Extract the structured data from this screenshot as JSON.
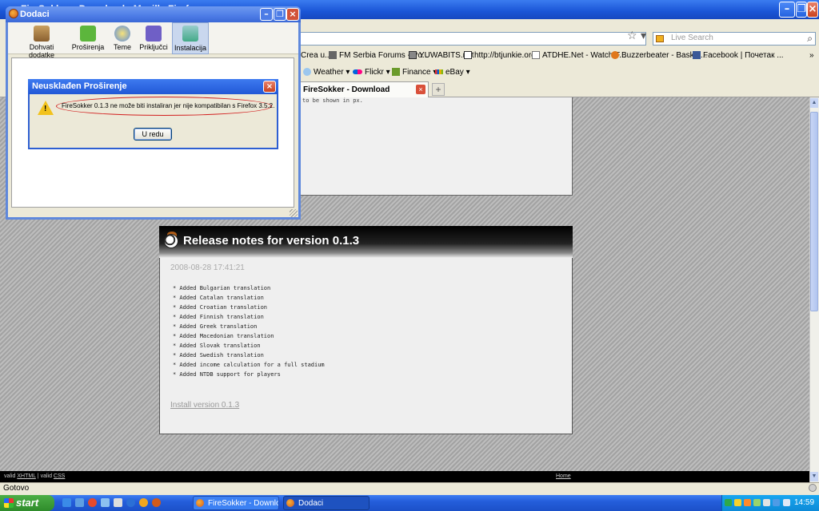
{
  "firefox": {
    "title": "FireSokker - Download - Mozilla Firefox",
    "search_placeholder": "Live Search",
    "bookmarks": [
      {
        "label": "Crea u...",
        "icon": "page-icon"
      },
      {
        "label": "FM Serbia Forums - Po...",
        "icon": "forum-icon"
      },
      {
        "label": "YUWABITS.net",
        "icon": "page-icon"
      },
      {
        "label": "http://btjunkie.org",
        "icon": "page-icon"
      },
      {
        "label": "ATDHE.Net - Watch F...",
        "icon": "page-icon"
      },
      {
        "label": "Buzzerbeater - Basket...",
        "icon": "basketball-icon"
      },
      {
        "label": "Facebook | Почетак ...",
        "icon": "facebook-icon"
      }
    ],
    "bookmarks2": [
      {
        "label": "Weather",
        "icon": "weather-icon"
      },
      {
        "label": "Flickr",
        "icon": "flickr-icon"
      },
      {
        "label": "Finance",
        "icon": "finance-icon"
      },
      {
        "label": "eBay",
        "icon": "ebay-icon"
      }
    ],
    "active_tab": "FireSokker - Download",
    "status": "Gotovo"
  },
  "page": {
    "top_panel_text": "to be shown in px.",
    "release_title": "Release notes for version 0.1.3",
    "release_date": "2008-08-28 17:41:21",
    "notes": [
      "* Added Bulgarian translation",
      "* Added Catalan translation",
      "* Added Croatian translation",
      "* Added Finnish translation",
      "* Added Greek translation",
      "* Added Macedonian translation",
      "* Added Slovak translation",
      "* Added Swedish translation",
      "* Added income calculation for a full stadium",
      "* Added NTDB support for players"
    ],
    "install_link": "Install version 0.1.3",
    "footer_valid": "valid",
    "footer_xhtml": "XHTML",
    "footer_sep": "|",
    "footer_css": "CSS",
    "footer_home": "Home"
  },
  "addons": {
    "title": "Dodaci",
    "toolbar": [
      {
        "label": "Dohvati dodatke",
        "icon": "get-addons-icon"
      },
      {
        "label": "Proširenja",
        "icon": "extensions-icon"
      },
      {
        "label": "Teme",
        "icon": "themes-icon"
      },
      {
        "label": "Priključci",
        "icon": "plugins-icon"
      },
      {
        "label": "Instalacija",
        "icon": "install-icon"
      }
    ],
    "selected": "Instalacija"
  },
  "dialog": {
    "title": "Neusklađen Proširenje",
    "message": "FireSokker 0.1.3 ne može biti instaliran jer nije kompatibilan s Firefox 3.5.2.",
    "ok": "U redu"
  },
  "taskbar": {
    "start": "start",
    "tasks": [
      "FireSokker - Downloa...",
      "Dodaci"
    ],
    "clock": "14:59"
  },
  "colors": {
    "titlebar": "#1a55d6",
    "taskbar": "#245edb",
    "start": "#3a9d35",
    "highlight_ellipse": "#d21f1f"
  }
}
